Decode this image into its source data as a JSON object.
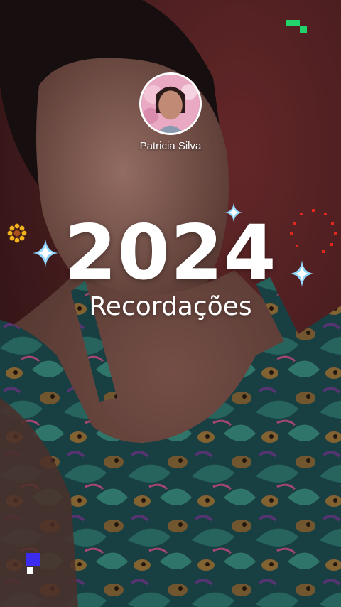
{
  "story": {
    "profile_name": "Patricia Silva",
    "year": "2024",
    "subtitle": "Recordações"
  },
  "icons": {
    "sparkles": [
      "sparkle-icon",
      "sparkle-icon",
      "sparkle-icon"
    ],
    "flower": "flower-icon",
    "dotted_ring": "dotted-ring-icon",
    "pixel_blocks": [
      "pixel-block-icon",
      "pixel-block-icon"
    ]
  },
  "colors": {
    "text": "#ffffff",
    "pixel_green": "#22d36a",
    "pixel_blue": "#3b2cf0",
    "ring_red": "#e0281e",
    "flower_yellow": "#f2b21b",
    "sparkle_blue": "#8fd6ff"
  }
}
